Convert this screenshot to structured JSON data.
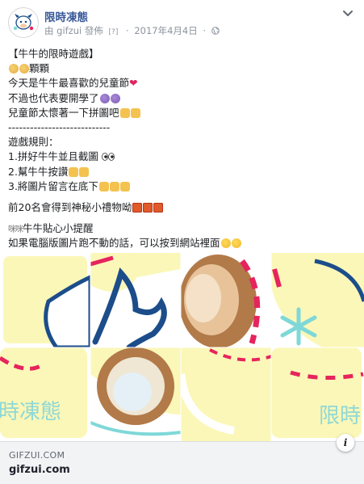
{
  "header": {
    "page_name": "限時凍態",
    "posted_by_prefix": "由",
    "author": "gifzui",
    "posted_verb": "發佈",
    "help_mark": "[?]",
    "date": "2017年4月4日",
    "separator": "·"
  },
  "icons": {
    "avatar": "avatar-logo",
    "globe": "globe-icon",
    "menu": "chevron-down-icon",
    "info": "info-icon"
  },
  "post": {
    "line1": "【牛牛的限時遊戲】",
    "line2": "顆顆",
    "line3": "今天是牛牛最喜歡的兒童節",
    "line4": "不過也代表要開學了",
    "line5": "兒童節太懷著一下拼圖吧",
    "divider": "----------------------------",
    "rules_title": "遊戲規則：",
    "rule1": "1.拼好牛牛並且截圖",
    "rule2": "2.幫牛牛按讚",
    "rule3": "3.將圖片留言在底下",
    "prize": "前20名會得到神秘小禮物呦",
    "tip_prefix": "咪咪",
    "tip_title": "牛牛貼心小提醒",
    "tip_body": "如果電腦版圖片跑不動的話，可以按到網站裡面"
  },
  "colors": {
    "link_blue": "#385898",
    "puzzle_yellow": "#fbf7b8",
    "puzzle_navy": "#1c4d8a",
    "puzzle_pink": "#e6245d",
    "puzzle_mint": "#7fd8d8",
    "footer_bg": "#f2f3f5"
  },
  "puzzle": {
    "text_left": "時凍態",
    "text_right": "限時"
  },
  "link": {
    "domain": "GIFZUI.COM",
    "title": "gifzui.com",
    "info_label": "i"
  }
}
